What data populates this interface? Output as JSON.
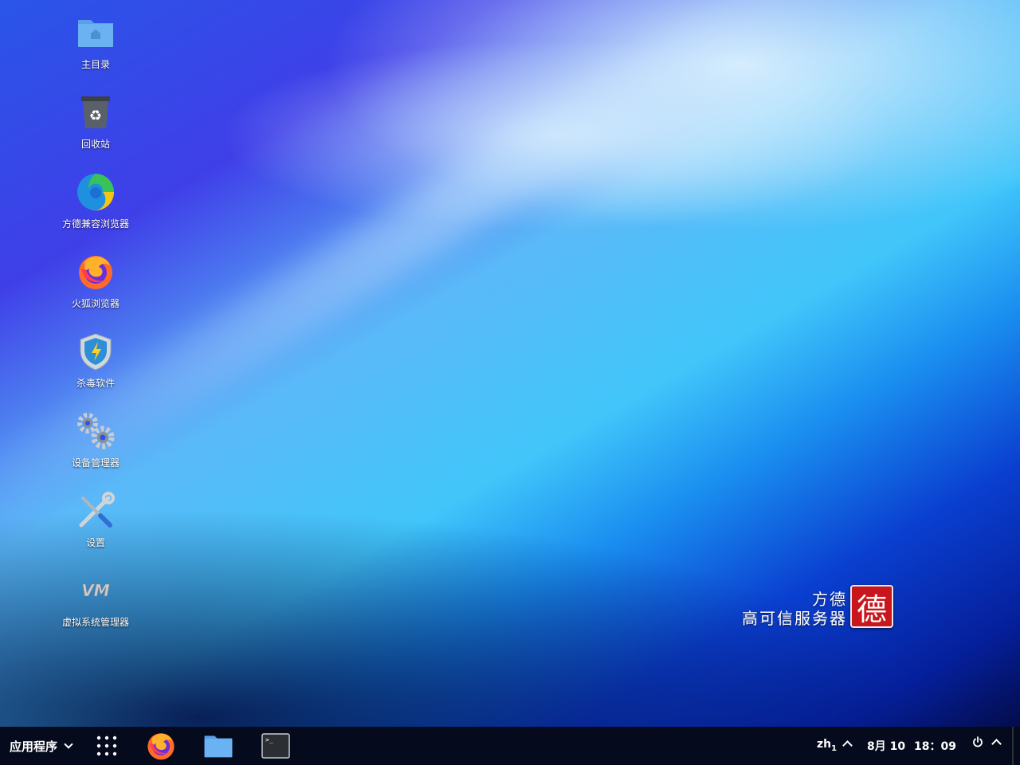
{
  "desktop_icons": [
    {
      "label": "主目录",
      "icon": "home-folder-icon"
    },
    {
      "label": "回收站",
      "icon": "trash-icon"
    },
    {
      "label": "方德兼容浏览器",
      "icon": "edge-browser-icon"
    },
    {
      "label": "火狐浏览器",
      "icon": "firefox-icon"
    },
    {
      "label": "杀毒软件",
      "icon": "antivirus-shield-icon"
    },
    {
      "label": "设备管理器",
      "icon": "gears-icon"
    },
    {
      "label": "设置",
      "icon": "settings-tools-icon"
    },
    {
      "label": "虚拟系统管理器",
      "icon": "vm-icon"
    }
  ],
  "brand": {
    "line1": "方德",
    "line2": "高可信服务器",
    "seal_char": "德",
    "seal_color": "#c9161d"
  },
  "taskbar": {
    "apps_menu_label": "应用程序",
    "pinned": [
      "app-grid-icon",
      "firefox-icon",
      "files-icon",
      "terminal-icon"
    ],
    "input_method": "zh",
    "input_method_sub": "1",
    "date": "8月 10",
    "time": "18：09",
    "power_icon": "power-icon"
  }
}
